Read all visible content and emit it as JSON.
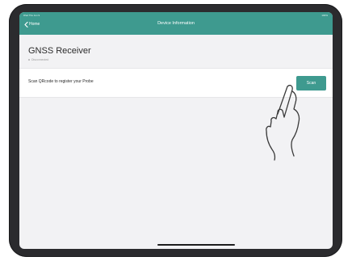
{
  "status_bar": {
    "left_text": "iPad  Thu Jun 9",
    "right_text": "100%"
  },
  "navbar": {
    "back_label": "Home",
    "title": "Device Information"
  },
  "device": {
    "title": "GNSS Receiver",
    "subtitle": "Disconnected"
  },
  "register_row": {
    "label": "Scan QRcode to register your Probe",
    "button_label": "Scan"
  },
  "colors": {
    "accent": "#3e9a8f",
    "background": "#f2f2f4",
    "bezel": "#2b2b2e"
  },
  "icons": {
    "back": "chevron-left-icon",
    "hand": "pointing-hand-icon"
  }
}
